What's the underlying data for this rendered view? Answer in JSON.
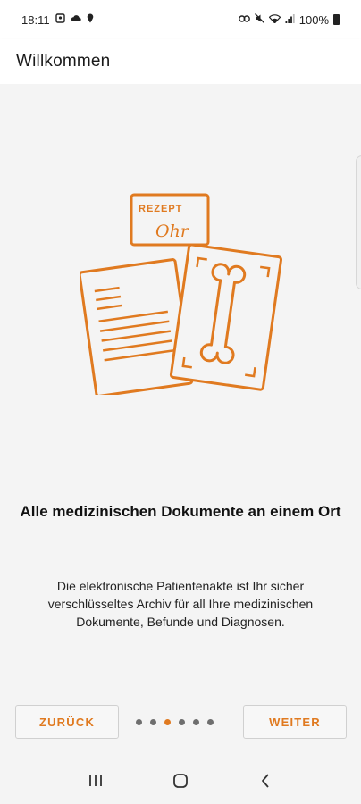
{
  "status_bar": {
    "time": "18:11",
    "battery": "100%",
    "left_icons": [
      "gallery-icon",
      "cloud-icon",
      "location-pin-icon"
    ],
    "right_icons": [
      "link-icon",
      "mute-icon",
      "wifi-icon",
      "signal-icon",
      "battery-icon"
    ]
  },
  "app_bar": {
    "title": "Willkommen"
  },
  "illustration": {
    "prescription_label": "REZEPT",
    "signature": "Ohr"
  },
  "onboarding": {
    "headline": "Alle medizinischen Dokumente an einem Ort",
    "description": "Die elektronische Patientenakte ist Ihr sicher verschlüsseltes Archiv für all Ihre medizinischen Dokumente, Befunde und Diagnosen.",
    "total_pages": 6,
    "current_page": 3
  },
  "buttons": {
    "back": "ZURÜCK",
    "next": "WEITER"
  },
  "colors": {
    "accent": "#e07a20",
    "background": "#f4f4f4",
    "dot_inactive": "#6e6e6e"
  },
  "nav_bar": {
    "icons": [
      "recent-apps-icon",
      "home-icon",
      "back-icon"
    ]
  }
}
